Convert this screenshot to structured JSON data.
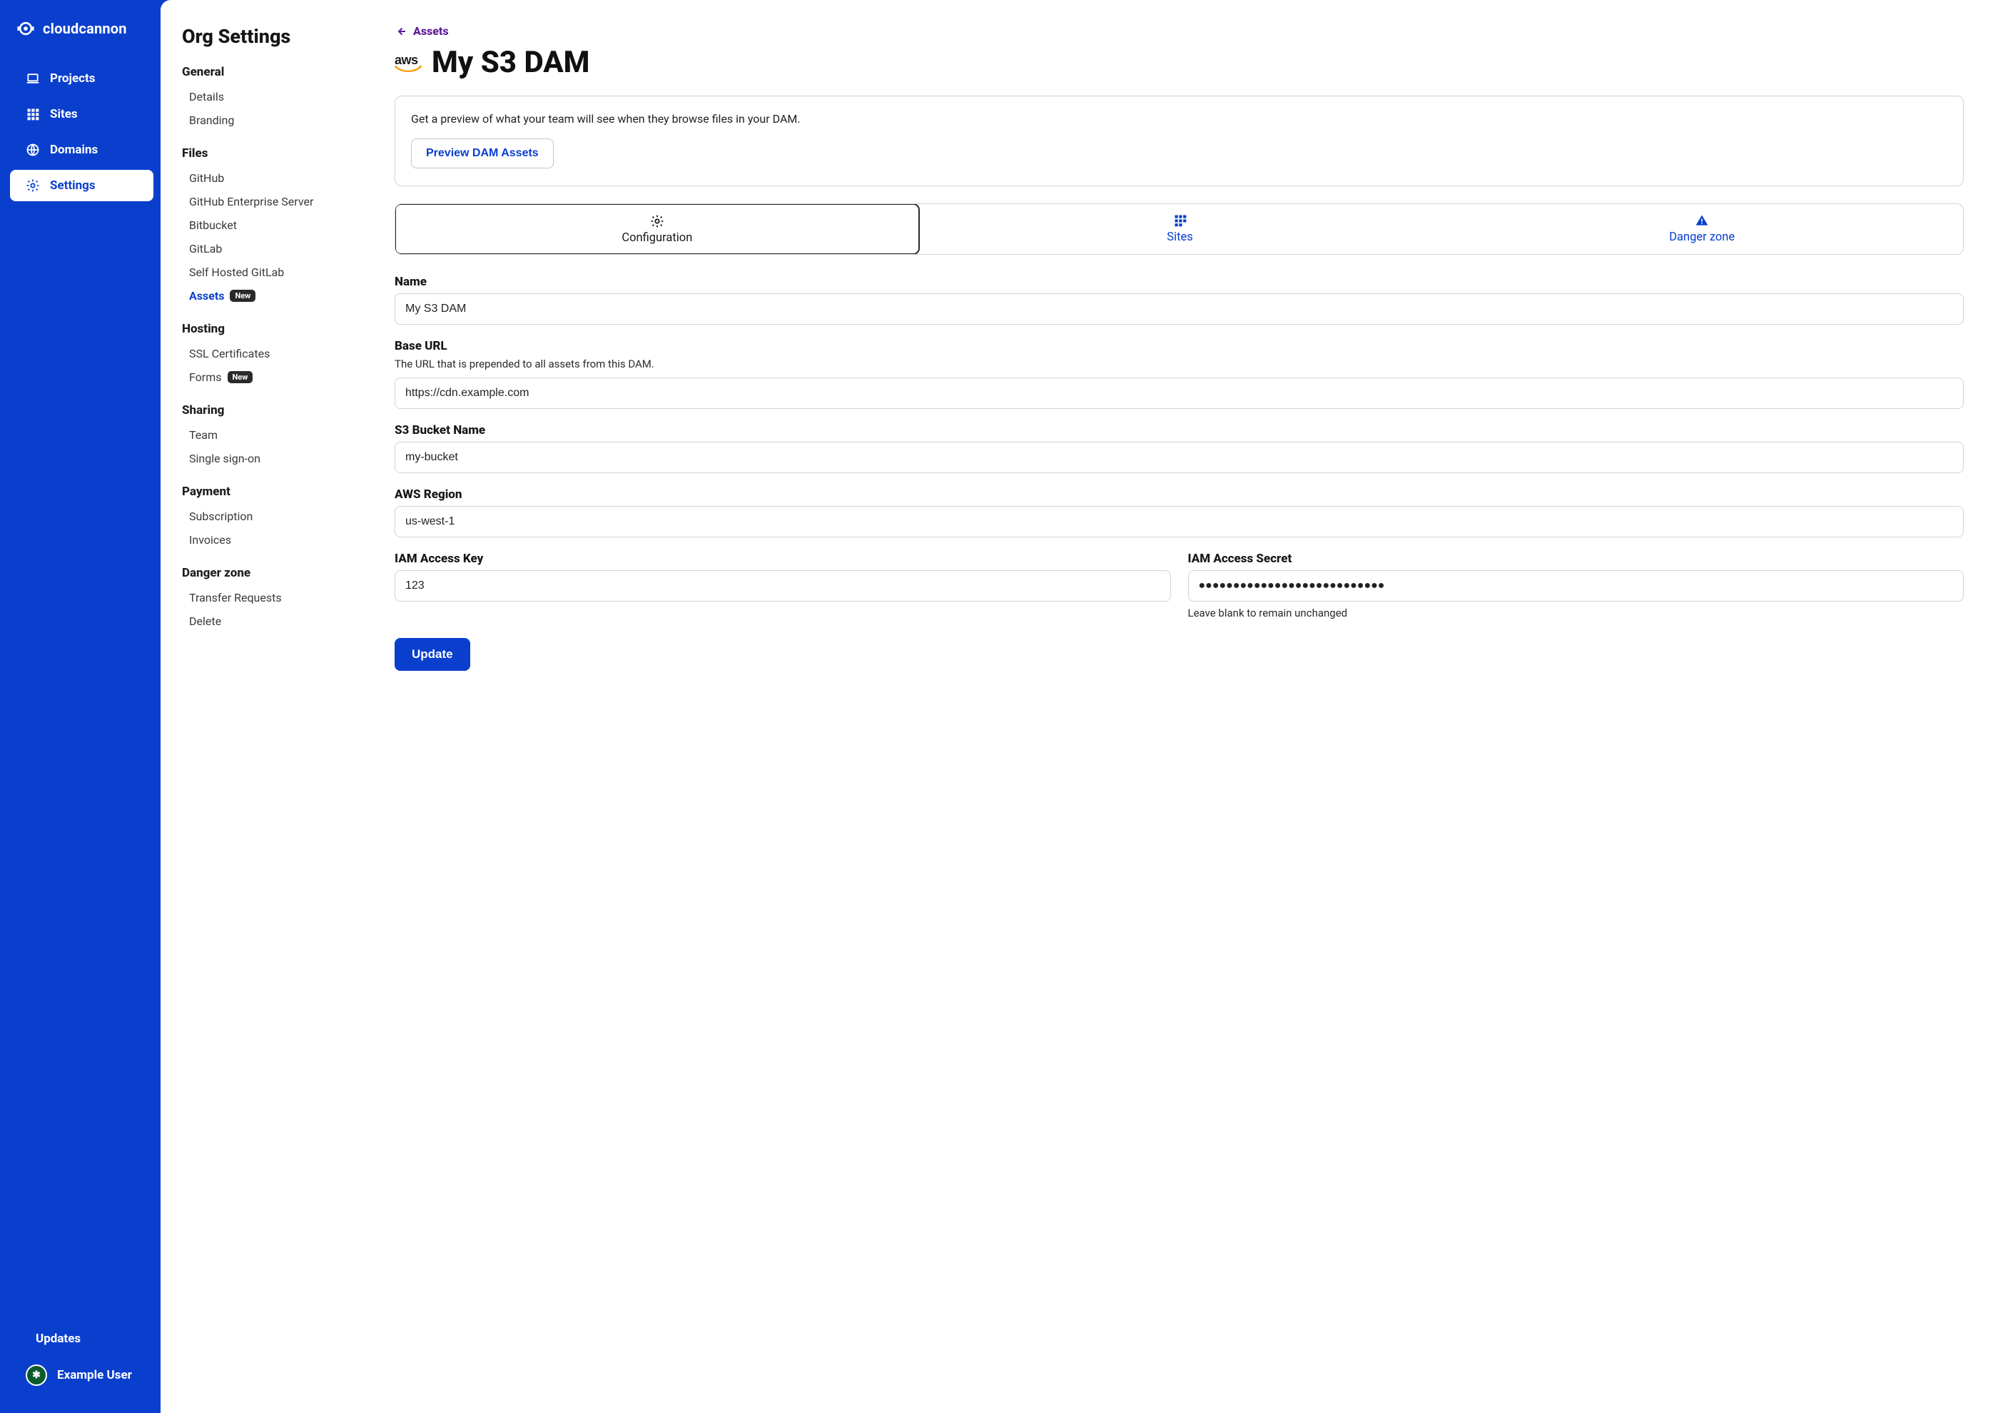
{
  "brand": {
    "name": "cloudcannon"
  },
  "sidebar": {
    "projects": "Projects",
    "sites": "Sites",
    "domains": "Domains",
    "settings": "Settings",
    "updates": "Updates",
    "user": "Example User"
  },
  "subnav": {
    "title": "Org Settings",
    "sections": {
      "general": {
        "title": "General",
        "details": "Details",
        "branding": "Branding"
      },
      "files": {
        "title": "Files",
        "github": "GitHub",
        "ghes": "GitHub Enterprise Server",
        "bitbucket": "Bitbucket",
        "gitlab": "GitLab",
        "self_gitlab": "Self Hosted GitLab",
        "assets": "Assets",
        "assets_badge": "New"
      },
      "hosting": {
        "title": "Hosting",
        "ssl": "SSL Certificates",
        "forms": "Forms",
        "forms_badge": "New"
      },
      "sharing": {
        "title": "Sharing",
        "team": "Team",
        "sso": "Single sign-on"
      },
      "payment": {
        "title": "Payment",
        "subscription": "Subscription",
        "invoices": "Invoices"
      },
      "danger": {
        "title": "Danger zone",
        "transfer": "Transfer Requests",
        "delete": "Delete"
      }
    }
  },
  "main": {
    "breadcrumb": "Assets",
    "title": "My S3 DAM",
    "preview": {
      "text": "Get a preview of what your team will see when they browse files in your DAM.",
      "button": "Preview DAM Assets"
    },
    "tabs": {
      "configuration": "Configuration",
      "sites": "Sites",
      "danger": "Danger zone"
    },
    "fields": {
      "name": {
        "label": "Name",
        "value": "My S3 DAM"
      },
      "base_url": {
        "label": "Base URL",
        "desc": "The URL that is prepended to all assets from this DAM.",
        "value": "https://cdn.example.com"
      },
      "bucket": {
        "label": "S3 Bucket Name",
        "value": "my-bucket"
      },
      "region": {
        "label": "AWS Region",
        "value": "us-west-1"
      },
      "iam_key": {
        "label": "IAM Access Key",
        "value": "123"
      },
      "iam_secret": {
        "label": "IAM Access Secret",
        "value": "●●●●●●●●●●●●●●●●●●●●●●●●●●●",
        "hint": "Leave blank to remain unchanged"
      }
    },
    "update_button": "Update"
  }
}
